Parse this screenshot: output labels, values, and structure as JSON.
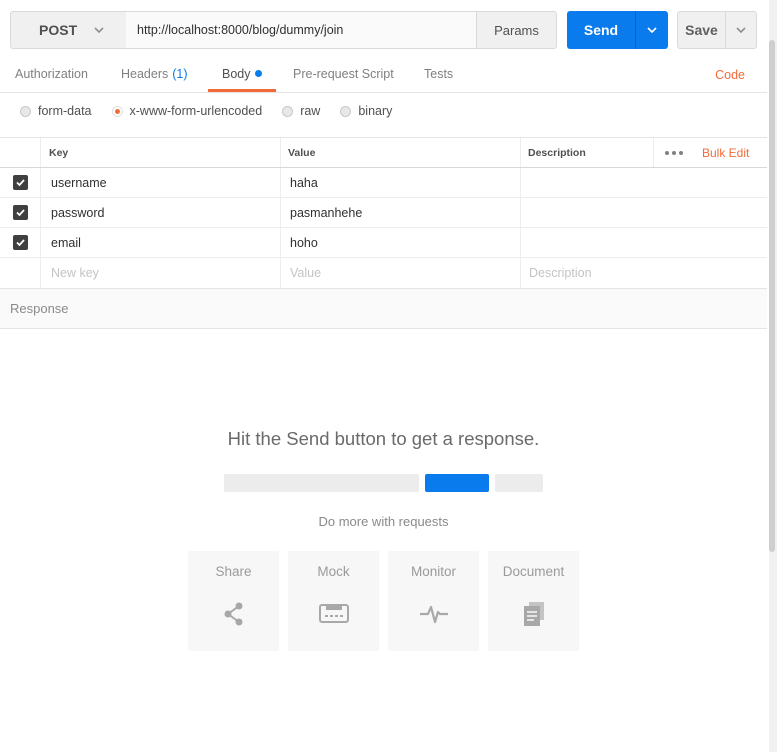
{
  "request": {
    "method": "POST",
    "url": "http://localhost:8000/blog/dummy/join",
    "params_label": "Params",
    "send_label": "Send",
    "save_label": "Save"
  },
  "tabs": [
    {
      "label": "Authorization",
      "count": ""
    },
    {
      "label": "Headers",
      "count": "(1)"
    },
    {
      "label": "Body",
      "count": "",
      "active": true
    },
    {
      "label": "Pre-request Script",
      "count": ""
    },
    {
      "label": "Tests",
      "count": ""
    }
  ],
  "code_link": "Code",
  "body_types": [
    {
      "label": "form-data",
      "selected": false
    },
    {
      "label": "x-www-form-urlencoded",
      "selected": true
    },
    {
      "label": "raw",
      "selected": false
    },
    {
      "label": "binary",
      "selected": false
    }
  ],
  "table": {
    "headers": {
      "key": "Key",
      "value": "Value",
      "description": "Description"
    },
    "bulk_edit": "Bulk Edit",
    "rows": [
      {
        "key": "username",
        "value": "haha",
        "description": "",
        "checked": true
      },
      {
        "key": "password",
        "value": "pasmanhehe",
        "description": "",
        "checked": true
      },
      {
        "key": "email",
        "value": "hoho",
        "description": "",
        "checked": true
      }
    ],
    "placeholders": {
      "key": "New key",
      "value": "Value",
      "description": "Description"
    }
  },
  "response": {
    "title": "Response",
    "hint": "Hit the Send button to get a response.",
    "do_more": "Do more with requests",
    "cards": [
      {
        "label": "Share",
        "icon": "share-icon"
      },
      {
        "label": "Mock",
        "icon": "mock-server-icon"
      },
      {
        "label": "Monitor",
        "icon": "monitor-pulse-icon"
      },
      {
        "label": "Document",
        "icon": "document-icon"
      }
    ]
  },
  "colors": {
    "accent_orange": "#f26b3a",
    "send_blue": "#097bed"
  }
}
